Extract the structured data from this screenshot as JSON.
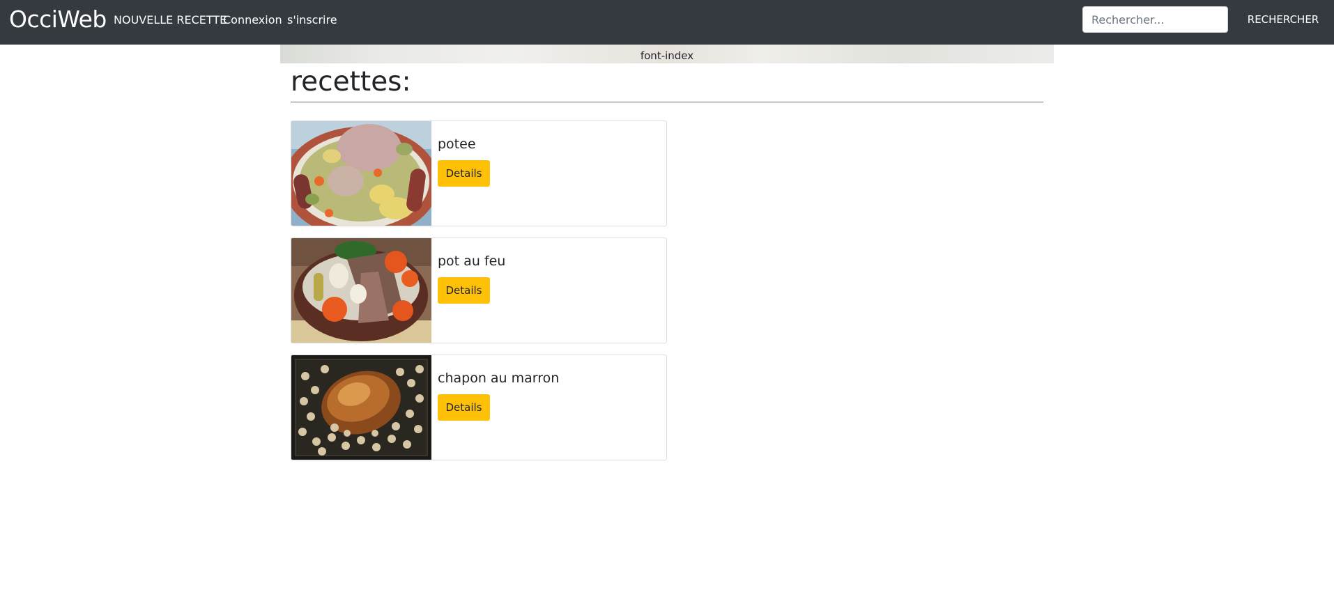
{
  "navbar": {
    "brand": "OcciWeb",
    "links": [
      "NOUVELLE RECETTE",
      "Connexion",
      "s'inscrire"
    ],
    "search": {
      "placeholder": "Rechercher...",
      "value": ""
    },
    "search_button": "RECHERCHER",
    "background": "#343a40"
  },
  "banner": {
    "text": "font-index"
  },
  "main": {
    "title": "recettes:",
    "recipes": [
      {
        "name": "potee",
        "button": "Details",
        "image": "potee-photo"
      },
      {
        "name": "pot au feu",
        "button": "Details",
        "image": "pot-au-feu-photo"
      },
      {
        "name": "chapon au marron",
        "button": "Details",
        "image": "chapon-au-marron-photo"
      }
    ]
  },
  "colors": {
    "accent_button": "#ffc107",
    "navbar": "#343a40"
  }
}
